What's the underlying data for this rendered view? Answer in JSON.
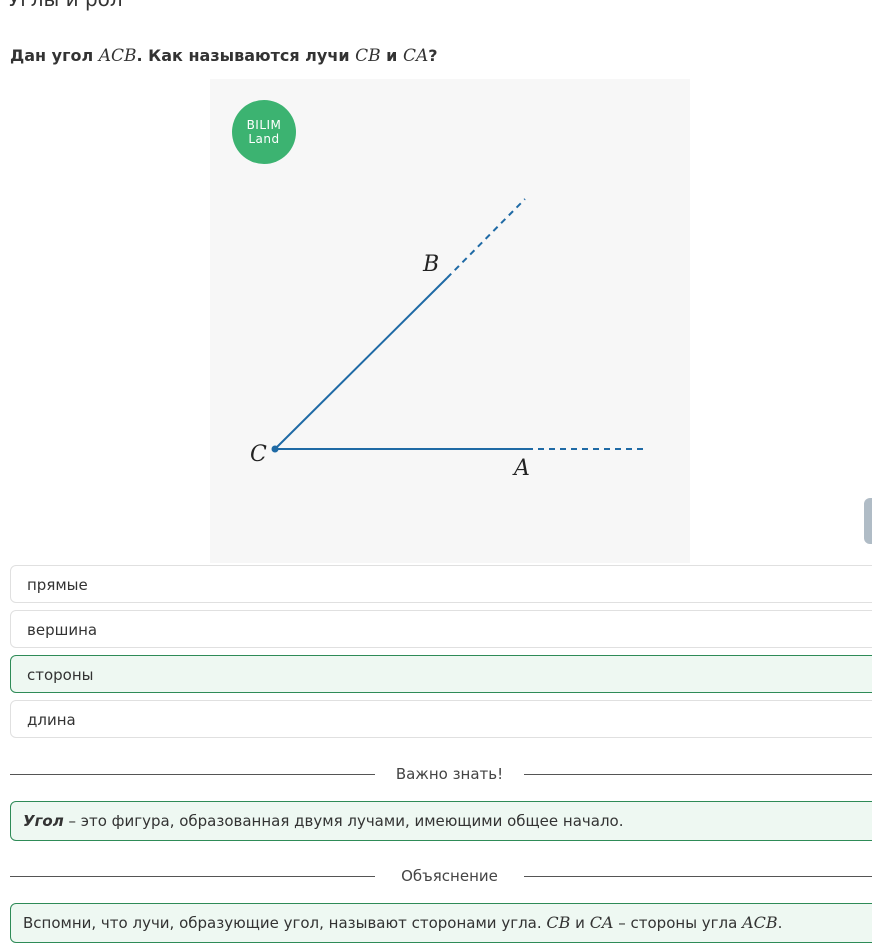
{
  "header": {
    "cut_title": "Углы и рол"
  },
  "question": {
    "prefix": "Дан угол ",
    "angle": "ACB",
    "middle": ". Как называются лучи ",
    "ray1": "CB",
    "and": " и ",
    "ray2": "CA",
    "suffix": "?"
  },
  "figure": {
    "logo_line1": "BILIM",
    "logo_line2": "Land",
    "label_c": "C",
    "label_b": "B",
    "label_a": "A",
    "colors": {
      "background": "#f7f7f7",
      "ray": "#1f6aa5",
      "logo": "#3cb371"
    }
  },
  "options": [
    {
      "label": "прямые",
      "selected": false
    },
    {
      "label": "вершина",
      "selected": false
    },
    {
      "label": "стороны",
      "selected": true
    },
    {
      "label": "длина",
      "selected": false
    }
  ],
  "important": {
    "heading": "Важно знать!",
    "term": "Угол",
    "text": " – это фигура, образованная двумя лучами, имеющими общее начало."
  },
  "explanation": {
    "heading": "Объяснение",
    "text1": "Вспомни, что лучи, образующие угол, называют сторонами угла. ",
    "ray1": "CB",
    "and": " и ",
    "ray2": "CA",
    "text2": " – стороны угла ",
    "angle": "ACB",
    "end": "."
  },
  "colors": {
    "accent": "#2e8b57",
    "selected_bg": "#eef8f2"
  }
}
